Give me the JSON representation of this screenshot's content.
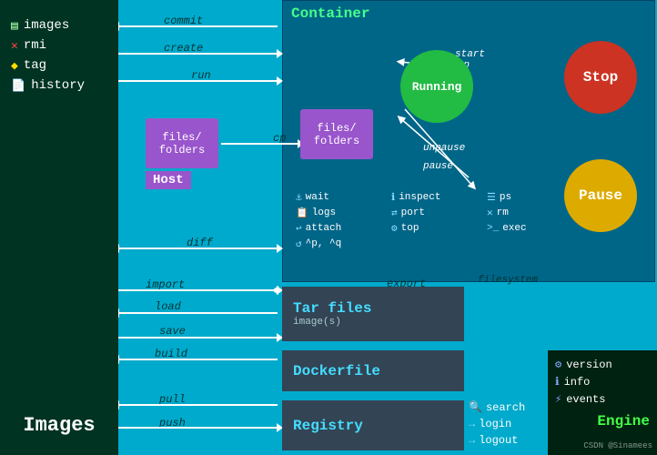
{
  "sidebar": {
    "items": [
      {
        "label": "images",
        "icon": "▤",
        "type": "grid"
      },
      {
        "label": "rmi",
        "icon": "✕",
        "type": "red-x"
      },
      {
        "label": "tag",
        "icon": "🏷",
        "type": "yellow-tag"
      },
      {
        "label": "history",
        "icon": "📄",
        "type": "doc"
      }
    ],
    "images_label": "Images"
  },
  "container": {
    "title": "Container",
    "running": "Running",
    "stop": "Stop",
    "pause": "Pause",
    "arrows": {
      "start": "start",
      "kill_stop": "kill, stop",
      "unpause": "unpause",
      "pause": "pause"
    },
    "files_folders": "files/\nfolders",
    "commands": [
      {
        "icon": "⚓",
        "label": "wait"
      },
      {
        "icon": "📋",
        "label": "logs"
      },
      {
        "icon": "↩",
        "label": "attach"
      },
      {
        "icon": "⌃",
        "label": "^p, ^q"
      },
      {
        "icon": "ℹ",
        "label": "inspect"
      },
      {
        "icon": "⇄",
        "label": "port"
      },
      {
        "icon": "☰",
        "label": "ps"
      },
      {
        "icon": "✕",
        "label": "rm"
      },
      {
        "icon": ">_",
        "label": "exec"
      },
      {
        "icon": "⚙",
        "label": "top"
      }
    ]
  },
  "flow": {
    "commit": "commit",
    "create": "create",
    "run": "run",
    "cp": "cp",
    "diff": "diff",
    "import": "import",
    "export": "export",
    "load": "load",
    "save": "save",
    "build": "build",
    "pull": "pull",
    "push": "push"
  },
  "tar_files": {
    "label": "Tar files",
    "filesystem": "filesystem",
    "images": "image(s)"
  },
  "dockerfile": {
    "label": "Dockerfile"
  },
  "registry": {
    "label": "Registry",
    "search": "search",
    "login": "login",
    "logout": "logout"
  },
  "engine": {
    "title": "Engine",
    "items": [
      {
        "icon": "⚙",
        "label": "version"
      },
      {
        "icon": "ℹ",
        "label": "info"
      },
      {
        "icon": "⚡",
        "label": "events"
      }
    ]
  },
  "host": {
    "files_folders": "files/\nfolders",
    "label": "Host"
  },
  "watermark": "CSDN @Sinamees"
}
